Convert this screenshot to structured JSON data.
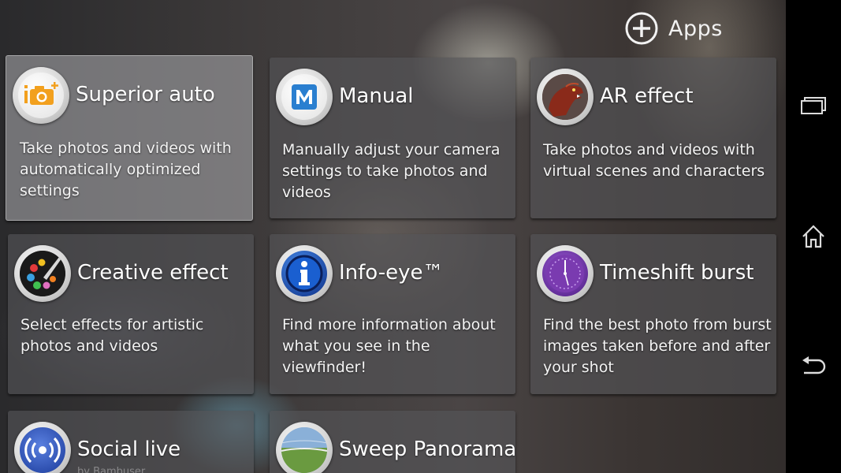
{
  "apps_button": {
    "label": "Apps",
    "icon": "plus-circle-icon"
  },
  "modes": [
    {
      "key": "superior-auto",
      "title": "Superior auto",
      "description": "Take photos and videos with automatically optimized settings",
      "icon": "camera-auto-icon",
      "selected": true
    },
    {
      "key": "manual",
      "title": "Manual",
      "description": "Manually adjust your camera settings to take photos and videos",
      "icon": "manual-m-icon"
    },
    {
      "key": "ar-effect",
      "title": "AR effect",
      "description": "Take photos and videos with virtual scenes and characters",
      "icon": "dinosaur-icon"
    },
    {
      "key": "creative-effect",
      "title": "Creative effect",
      "description": "Select effects for artistic photos and videos",
      "icon": "palette-icon"
    },
    {
      "key": "info-eye",
      "title": "Info-eye™",
      "description": "Find more information about what you see in the viewfinder!",
      "icon": "info-icon"
    },
    {
      "key": "timeshift-burst",
      "title": "Timeshift burst",
      "description": "Find the best photo from burst images taken before and after your shot",
      "icon": "timeshift-clock-icon"
    },
    {
      "key": "social-live",
      "title": "Social live",
      "subtitle": "by Bambuser",
      "description": "",
      "icon": "broadcast-icon"
    },
    {
      "key": "sweep-panorama",
      "title": "Sweep Panorama",
      "description": "",
      "icon": "panorama-icon"
    }
  ],
  "navigation": {
    "recent_apps": "recent-apps-icon",
    "home": "home-icon",
    "back": "back-icon"
  },
  "colors": {
    "navbar": "#000000",
    "tile": "#555558",
    "tile_selected": "#afafb2",
    "text": "#ffffff",
    "auto_icon_orange": "#f2a01e",
    "manual_icon_blue": "#2a7fd0",
    "info_icon_blue": "#1a5fd0",
    "timeshift_purple": "#7a3bb0"
  }
}
